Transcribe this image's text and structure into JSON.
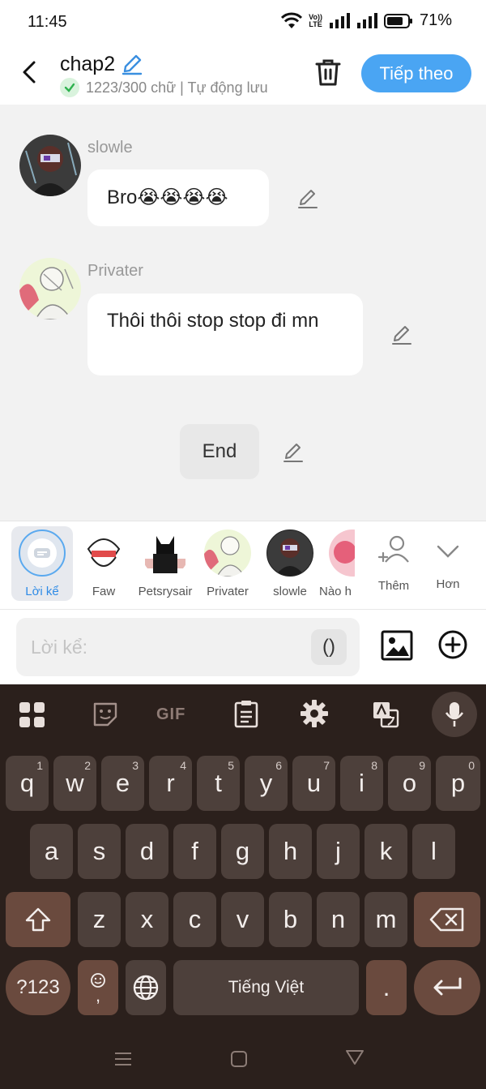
{
  "status_bar": {
    "time": "11:45",
    "volte_top": "Vo))",
    "volte_bottom": "LTE",
    "battery": "71%"
  },
  "header": {
    "title": "chap2",
    "subtitle": "1223/300 chữ | Tự động lưu",
    "next_button": "Tiếp theo"
  },
  "messages": [
    {
      "sender": "slowle",
      "text": "Bro😭😭😭😭"
    },
    {
      "sender": "Privater",
      "text": "Thôi thôi stop stop đi mn"
    }
  ],
  "end_label": "End",
  "characters": [
    {
      "name": "Lời kể",
      "selected": true
    },
    {
      "name": "Faw"
    },
    {
      "name": "Petsrysair"
    },
    {
      "name": "Privater"
    },
    {
      "name": "slowle"
    },
    {
      "name": "Nào h"
    }
  ],
  "add_label": "Thêm",
  "more_label": "Hơn",
  "input": {
    "placeholder": "Lời kể:",
    "paren": "()"
  },
  "keyboard": {
    "gif": "GIF",
    "row1": [
      {
        "k": "q",
        "h": "1"
      },
      {
        "k": "w",
        "h": "2"
      },
      {
        "k": "e",
        "h": "3"
      },
      {
        "k": "r",
        "h": "4"
      },
      {
        "k": "t",
        "h": "5"
      },
      {
        "k": "y",
        "h": "6"
      },
      {
        "k": "u",
        "h": "7"
      },
      {
        "k": "i",
        "h": "8"
      },
      {
        "k": "o",
        "h": "9"
      },
      {
        "k": "p",
        "h": "0"
      }
    ],
    "row2": [
      "a",
      "s",
      "d",
      "f",
      "g",
      "h",
      "j",
      "k",
      "l"
    ],
    "row3": [
      "z",
      "x",
      "c",
      "v",
      "b",
      "n",
      "m"
    ],
    "symbols": "?123",
    "emoji_comma": ",",
    "space": "Tiếng Việt",
    "period": "."
  },
  "colors": {
    "accent": "#4aa5f3",
    "keyboard_bg": "#2b201c",
    "key": "#4d403b"
  }
}
